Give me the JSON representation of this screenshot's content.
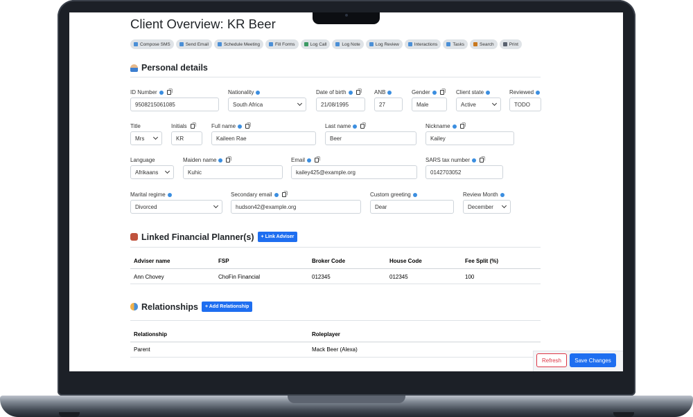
{
  "page": {
    "title": "Client Overview: KR Beer"
  },
  "toolbar": [
    {
      "label": "Compose SMS",
      "icon": "sms-icon"
    },
    {
      "label": "Send Email",
      "icon": "send-icon"
    },
    {
      "label": "Schedule Meeting",
      "icon": "calendar-icon"
    },
    {
      "label": "Fill Forms",
      "icon": "form-icon"
    },
    {
      "label": "Log Call",
      "icon": "phone-icon"
    },
    {
      "label": "Log Note",
      "icon": "note-icon"
    },
    {
      "label": "Log Review",
      "icon": "check-icon"
    },
    {
      "label": "Interactions",
      "icon": "interactions-icon"
    },
    {
      "label": "Tasks",
      "icon": "tasks-icon"
    },
    {
      "label": "Search",
      "icon": "search-icon"
    },
    {
      "label": "Print",
      "icon": "printer-icon"
    }
  ],
  "personal": {
    "heading": "Personal details",
    "id_number": {
      "label": "ID Number",
      "value": "9508215061085"
    },
    "nationality": {
      "label": "Nationality",
      "value": "South Africa"
    },
    "dob": {
      "label": "Date of birth",
      "value": "21/08/1995"
    },
    "anb": {
      "label": "ANB",
      "value": "27"
    },
    "gender": {
      "label": "Gender",
      "value": "Male"
    },
    "client_state": {
      "label": "Client state",
      "value": "Active"
    },
    "reviewed": {
      "label": "Reviewed",
      "value": "TODO"
    },
    "title": {
      "label": "Title",
      "value": "Mrs"
    },
    "initials": {
      "label": "Initials",
      "value": "KR"
    },
    "full_name": {
      "label": "Full name",
      "value": "Kaileen Rae"
    },
    "last_name": {
      "label": "Last name",
      "value": "Beer"
    },
    "nickname": {
      "label": "Nickname",
      "value": "Kailey"
    },
    "language": {
      "label": "Language",
      "value": "Afrikaans"
    },
    "maiden_name": {
      "label": "Maiden name",
      "value": "Kuhic"
    },
    "email": {
      "label": "Email",
      "value": "kailey425@example.org"
    },
    "sars": {
      "label": "SARS tax number",
      "value": "0142703052"
    },
    "marital": {
      "label": "Marital regime",
      "value": "Divorced"
    },
    "secondary_email": {
      "label": "Secondary email",
      "value": "hudson42@example.org"
    },
    "greeting": {
      "label": "Custom greeting",
      "value": "Dear"
    },
    "review_month": {
      "label": "Review Month",
      "value": "December"
    }
  },
  "planners": {
    "heading": "Linked Financial Planner(s)",
    "add_label": "+ Link Adviser",
    "columns": [
      "Adviser name",
      "FSP",
      "Broker Code",
      "House Code",
      "Fee Split (%)"
    ],
    "rows": [
      [
        "Ann Chovey",
        "ChoFin Financial",
        "012345",
        "012345",
        "100"
      ]
    ]
  },
  "relationships": {
    "heading": "Relationships",
    "add_label": "+ Add Relationship",
    "columns": [
      "Relationship",
      "Roleplayer"
    ],
    "rows": [
      [
        "Parent",
        "Mack Beer (Alexa)"
      ]
    ]
  },
  "footer": {
    "refresh_label": "Refresh",
    "save_label": "Save Changes"
  },
  "colors": {
    "primary": "#1e6ef0",
    "danger": "#dc3545",
    "info": "#3b8ee0"
  }
}
